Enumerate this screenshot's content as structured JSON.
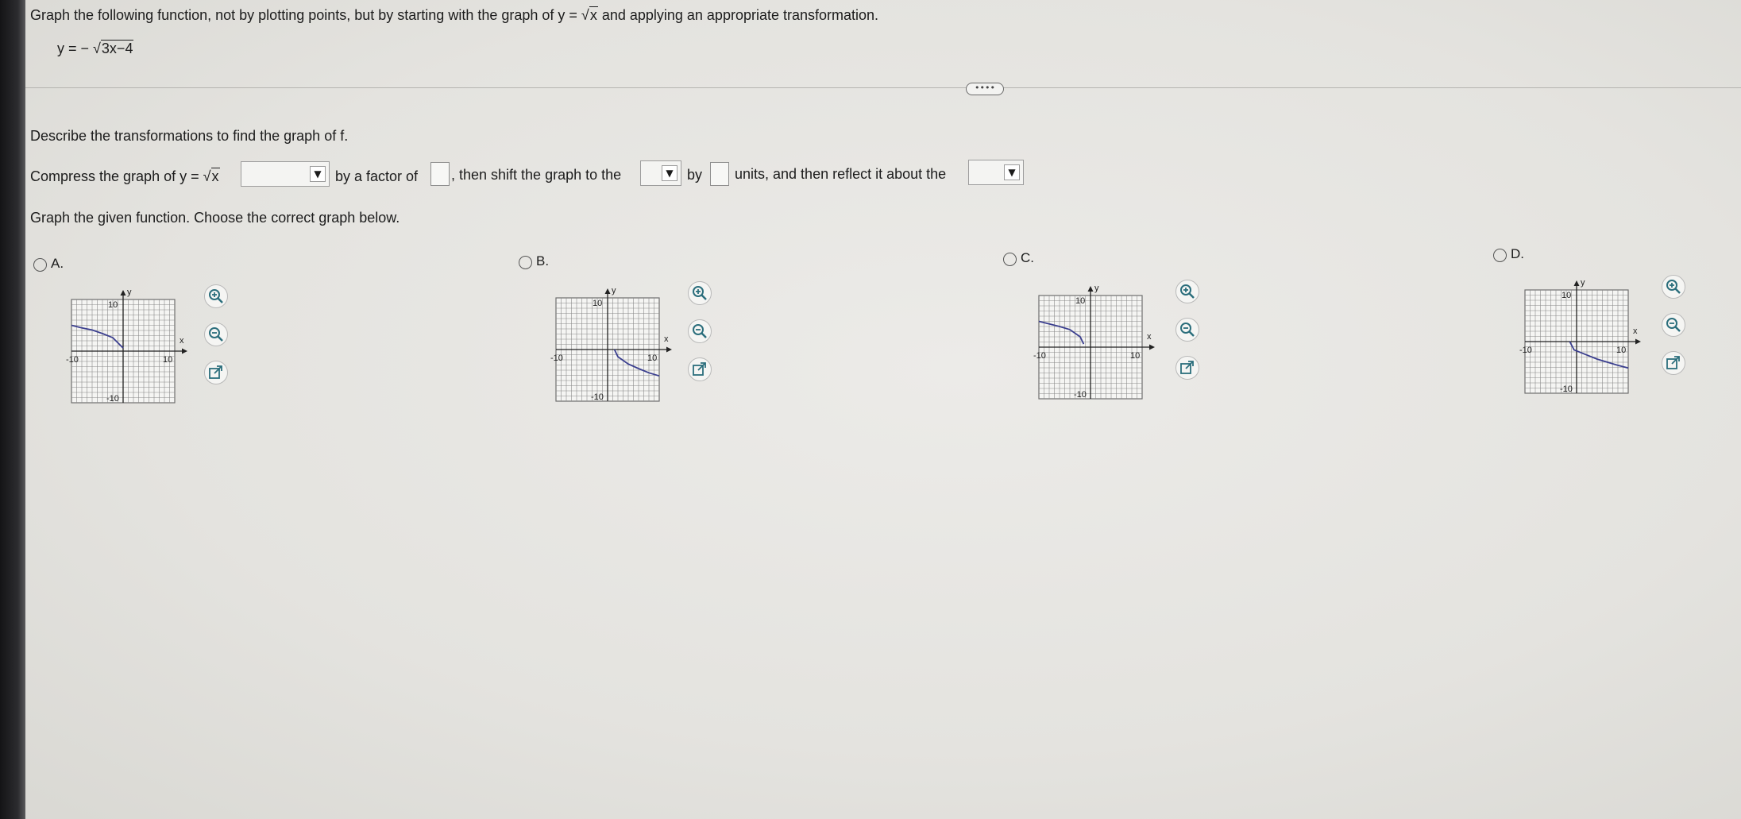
{
  "question": {
    "prompt_before": "Graph the following function, not by plotting points, but by starting with the graph of y = ",
    "prompt_radicand": "x",
    "prompt_after": " and applying an appropriate transformation.",
    "function_prefix": "y = − ",
    "function_radicand": "3x−4"
  },
  "more_button": "••••",
  "part1": {
    "heading": "Describe the transformations to find the graph of f.",
    "compress_text": "Compress the graph of y = ",
    "compress_radicand": "x",
    "dropdown_arrow": "▼",
    "by_factor_text": "by a factor of",
    "shift_text": ", then shift the graph to the",
    "by_text": "by",
    "units_text": "units, and then reflect it about the"
  },
  "part2": {
    "heading": "Graph the given function. Choose the correct graph below."
  },
  "options": [
    {
      "label": "A.",
      "axis": {
        "ylabel": "y",
        "xlabel": "x",
        "ytop": "10",
        "ybottom": "-10",
        "xleft": "-10",
        "xright": "10"
      }
    },
    {
      "label": "B.",
      "axis": {
        "ylabel": "y",
        "xlabel": "x",
        "ytop": "10",
        "ybottom": "-10",
        "xleft": "-10",
        "xright": "10"
      }
    },
    {
      "label": "C.",
      "axis": {
        "ylabel": "y",
        "xlabel": "x",
        "ytop": "10",
        "ybottom": "-10",
        "xleft": "-10",
        "xright": "10"
      }
    },
    {
      "label": "D.",
      "axis": {
        "ylabel": "y",
        "xlabel": "x",
        "ytop": "10",
        "ybottom": "-10",
        "xleft": "-10",
        "xright": "10"
      }
    }
  ],
  "icons": {
    "zoom_in": "zoom-in-icon",
    "zoom_out": "zoom-out-icon",
    "open_new": "open-in-new-window-icon"
  },
  "colors": {
    "curve": "#3b3f8f",
    "grid": "#8a8a8a"
  },
  "chart_data": [
    {
      "type": "line",
      "xlim": [
        -10,
        10
      ],
      "ylim": [
        -10,
        10
      ],
      "grid": true,
      "series": [
        {
          "x": [
            -10,
            -8,
            -6,
            -4,
            -2,
            0
          ],
          "y": [
            5.0,
            4.5,
            4.1,
            3.4,
            2.6,
            0.6
          ]
        }
      ]
    },
    {
      "type": "line",
      "xlim": [
        -10,
        10
      ],
      "ylim": [
        -10,
        10
      ],
      "grid": true,
      "series": [
        {
          "x": [
            1.33,
            2,
            4,
            6,
            8,
            10
          ],
          "y": [
            0,
            -1.4,
            -2.8,
            -3.7,
            -4.5,
            -5.1
          ]
        }
      ]
    },
    {
      "type": "line",
      "xlim": [
        -10,
        10
      ],
      "ylim": [
        -10,
        10
      ],
      "grid": true,
      "series": [
        {
          "x": [
            -10,
            -8,
            -6,
            -4,
            -2,
            -1.33
          ],
          "y": [
            5.0,
            4.5,
            4.0,
            3.4,
            2.0,
            0.6
          ]
        }
      ]
    },
    {
      "type": "line",
      "xlim": [
        -10,
        10
      ],
      "ylim": [
        -10,
        10
      ],
      "grid": true,
      "series": [
        {
          "x": [
            -1.33,
            -0.5,
            2,
            4,
            6,
            8,
            10
          ],
          "y": [
            0,
            -1.6,
            -2.6,
            -3.4,
            -4.0,
            -4.6,
            -5.1
          ]
        }
      ]
    }
  ]
}
